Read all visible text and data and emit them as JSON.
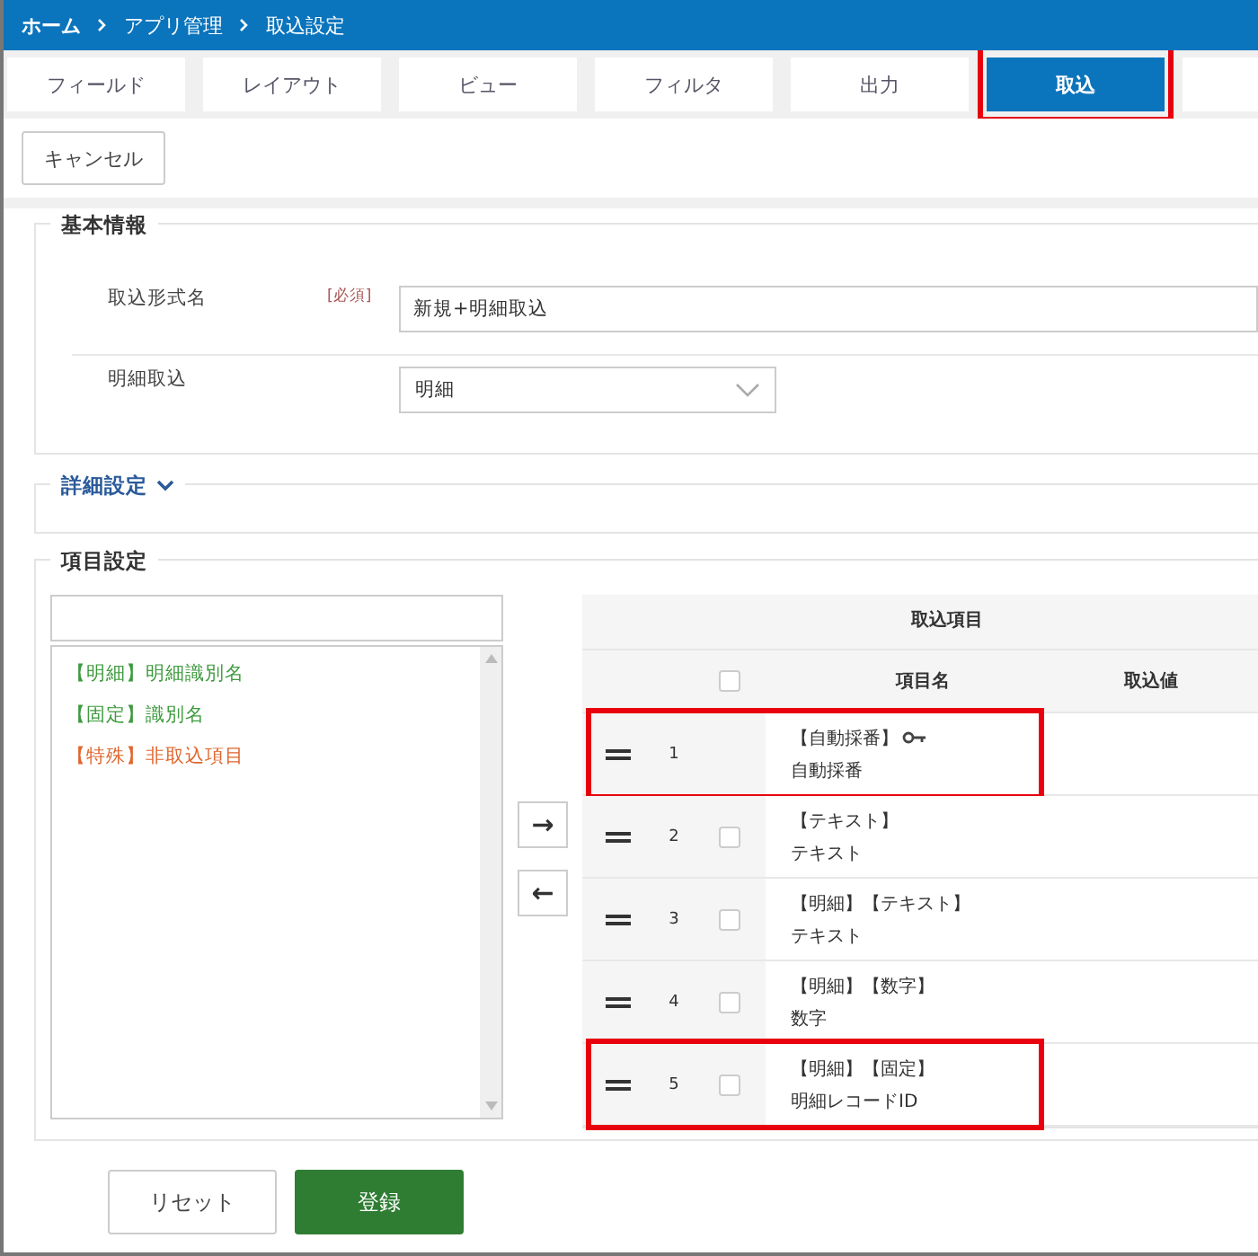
{
  "breadcrumb": [
    "ホーム",
    "アプリ管理",
    "取込設定"
  ],
  "tabs": [
    {
      "label": "フィールド",
      "selected": false,
      "highlighted": false
    },
    {
      "label": "レイアウト",
      "selected": false,
      "highlighted": false
    },
    {
      "label": "ビュー",
      "selected": false,
      "highlighted": false
    },
    {
      "label": "フィルタ",
      "selected": false,
      "highlighted": false
    },
    {
      "label": "出力",
      "selected": false,
      "highlighted": false
    },
    {
      "label": "取込",
      "selected": true,
      "highlighted": true
    }
  ],
  "cancel_button": "キャンセル",
  "basic_info": {
    "legend": "基本情報",
    "format_name": {
      "label": "取込形式名",
      "required": "[必須]",
      "value": "新規+明細取込"
    },
    "detail_import": {
      "label": "明細取込",
      "value": "明細"
    }
  },
  "advanced": {
    "legend": "詳細設定",
    "expanded": false
  },
  "items": {
    "legend": "項目設定",
    "available": [
      {
        "text": "【明細】明細識別名",
        "color": "#3f9a3f"
      },
      {
        "text": "【固定】識別名",
        "color": "#3f9a3f"
      },
      {
        "text": "【特殊】非取込項目",
        "color": "#e0662e"
      }
    ],
    "move_right": "→",
    "move_left": "←",
    "table_title": "取込項目",
    "columns": [
      "項目名",
      "取込値"
    ],
    "header_checked": false,
    "rows": [
      {
        "kind": "key",
        "number": "1",
        "type": "【自動採番】",
        "name": "自動採番",
        "highlighted": true
      },
      {
        "kind": "plain",
        "number": "2",
        "type": "【テキスト】",
        "name": "テキスト",
        "checked": false,
        "highlighted": false
      },
      {
        "kind": "plain",
        "number": "3",
        "type": "【明細】【テキスト】",
        "name": "テキスト",
        "checked": false,
        "highlighted": false
      },
      {
        "kind": "plain",
        "number": "4",
        "type": "【明細】【数字】",
        "name": "数字",
        "checked": false,
        "highlighted": false
      },
      {
        "kind": "plain",
        "number": "5",
        "type": "【明細】【固定】",
        "name": "明細レコードID",
        "checked": false,
        "highlighted": true
      }
    ]
  },
  "footer": {
    "reset": "リセット",
    "submit": "登録"
  }
}
